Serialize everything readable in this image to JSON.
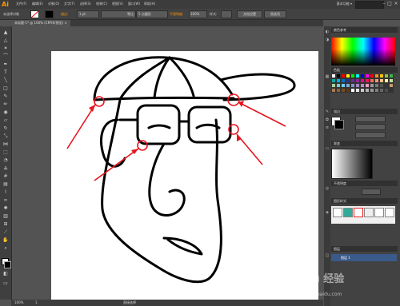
{
  "app": {
    "logo": "Ai"
  },
  "menu": {
    "items": [
      "文件(F)",
      "编辑(E)",
      "对象(O)",
      "文字(T)",
      "选择(S)",
      "效果(C)",
      "视图(V)",
      "窗口(W)",
      "帮助(H)"
    ]
  },
  "workspace": {
    "label": "基本功能 ▾"
  },
  "control": {
    "selection_label": "未选择对象",
    "stroke_label": "描边:",
    "stroke_value": "1 pt",
    "stroke_style": "等比",
    "brush_value": "5 点圆形",
    "opacity_label": "不透明度:",
    "opacity_value": "100%",
    "style_label": "样式:",
    "doc_setup": "文档设置",
    "preferences": "首选项"
  },
  "document": {
    "tab_title": "未标题-1* @ 100% (CMYK/预览)",
    "tab_close": "×"
  },
  "status": {
    "zoom": "100%",
    "page": "1",
    "tool_name": "直接选择"
  },
  "panels": {
    "color_header": "颜色参考",
    "swatches_header": "色板",
    "stroke_header": "描边",
    "gradient_header": "渐变",
    "opacity_header": "不透明度",
    "graphic_styles_header": "图形样式",
    "layers_header": "图层",
    "layer_name": "图层 1"
  },
  "swatch_colors": [
    "#ffffff",
    "#000000",
    "#ff0000",
    "#ffff00",
    "#00ff00",
    "#00ffff",
    "#0000ff",
    "#ff00ff",
    "#ff0000",
    "#f7941d",
    "#ffc20e",
    "#8dc63f",
    "#39b54a",
    "#00a99d",
    "#00aeef",
    "#0072bc",
    "#2e3192",
    "#662d91",
    "#92278f",
    "#ec008c",
    "#ed145b",
    "#f26c4f",
    "#f69679",
    "#fdc689",
    "#fff799",
    "#c4df9b",
    "#a3d39c",
    "#7accc8",
    "#6dcff6",
    "#7da7d9",
    "#8393ca",
    "#a186be",
    "#bd8cbf",
    "#f49ac2",
    "#999999",
    "#777777",
    "#555555",
    "#333333",
    "#c69c6d",
    "#a67c52",
    "#8c6239",
    "#754c24",
    "#603913",
    "#ffffff",
    "#e6e6e6",
    "#cccccc",
    "#b3b3b3",
    "#999999",
    "#808080",
    "#666666",
    "#4d4d4d",
    "#333333"
  ],
  "annotation_color": "#e8141e",
  "watermark": {
    "brand": "Baidu 经验",
    "url": "jingyan.baidu.com"
  }
}
